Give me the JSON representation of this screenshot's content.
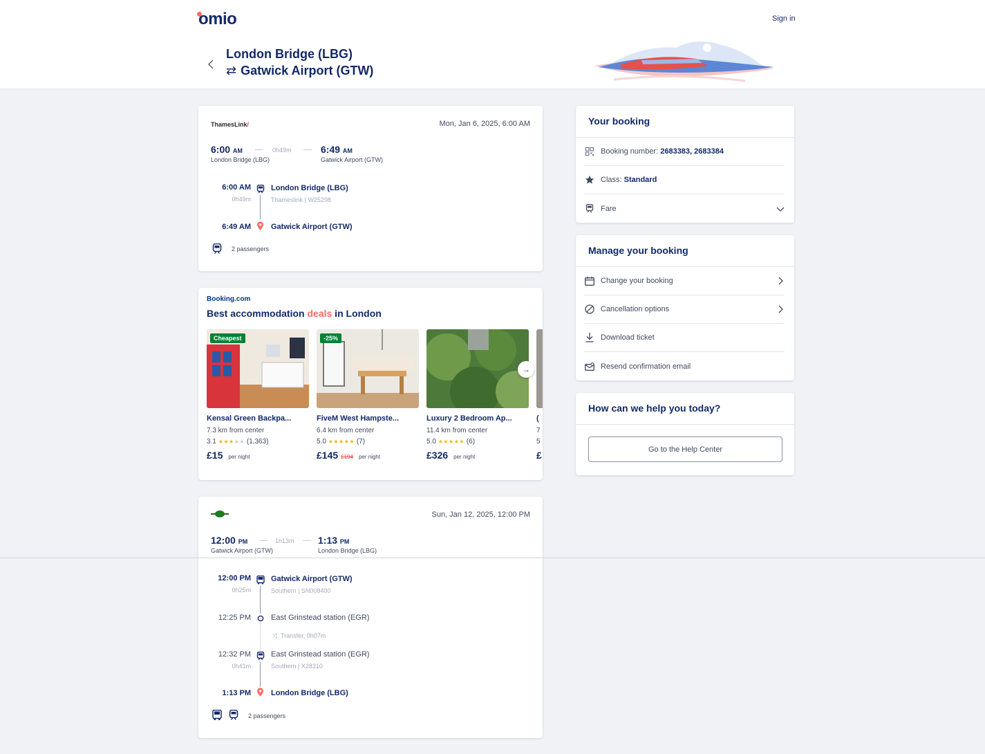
{
  "header": {
    "logo": "omio",
    "signin": "Sign in",
    "from": "London Bridge (LBG)",
    "to": "Gatwick Airport (GTW)"
  },
  "outbound": {
    "operator": "ThamesLink",
    "date": "Mon, Jan 6, 2025, 6:00 AM",
    "dep_time": "6:00",
    "dep_ampm": "AM",
    "dep_station": "London Bridge (LBG)",
    "duration": "0h49m",
    "arr_time": "6:49",
    "arr_ampm": "AM",
    "arr_station": "Gatwick Airport (GTW)",
    "legs": [
      {
        "time": "6:00 AM",
        "dur": "0h49m",
        "station": "London Bridge (LBG)",
        "sub": "Thameslink | W25298"
      },
      {
        "time": "6:49 AM",
        "station": "Gatwick Airport (GTW)"
      }
    ],
    "passengers": "2 passengers"
  },
  "accommodation": {
    "provider": "Booking.com",
    "title_start": "Best accommodation ",
    "title_deal": "deals",
    "title_end": " in London",
    "hotels": [
      {
        "badge": "Cheapest",
        "name": "Kensal Green Backpa...",
        "dist": "7.3 km from center",
        "score": "3.1",
        "stars": 3,
        "reviews": "(1,363)",
        "price": "£15",
        "old_price": "",
        "per": "per night"
      },
      {
        "badge": "-25%",
        "name": "FiveM West Hampste...",
        "dist": "6.4 km from center",
        "score": "5.0",
        "stars": 5,
        "reviews": "(7)",
        "price": "£145",
        "old_price": "£194",
        "per": "per night"
      },
      {
        "badge": "",
        "name": "Luxury 2 Bedroom Ap...",
        "dist": "11.4 km from center",
        "score": "5.0",
        "stars": 5,
        "reviews": "(6)",
        "price": "£326",
        "old_price": "",
        "per": "per night"
      }
    ],
    "overflow_letters": [
      "(",
      "7",
      "5",
      "£"
    ]
  },
  "return": {
    "date": "Sun, Jan 12, 2025, 12:00 PM",
    "dep_time": "12:00",
    "dep_ampm": "PM",
    "dep_station": "Gatwick Airport (GTW)",
    "duration": "1h13m",
    "arr_time": "1:13",
    "arr_ampm": "PM",
    "arr_station": "London Bridge (LBG)",
    "legs": [
      {
        "time": "12:00 PM",
        "dur": "0h25m",
        "station": "Gatwick Airport (GTW)",
        "sub": "Southern | SN008400"
      },
      {
        "time": "12:25 PM",
        "station": "East Grinstead station (EGR)"
      },
      {
        "transfer": "Transfer, 0h07m"
      },
      {
        "time": "12:32 PM",
        "dur": "0h41m",
        "station": "East Grinstead station (EGR)",
        "sub": "Southern | X28310"
      },
      {
        "time": "1:13 PM",
        "station": "London Bridge (LBG)"
      }
    ],
    "passengers": "2 passengers"
  },
  "your_booking": {
    "title": "Your booking",
    "booking_label": "Booking number: ",
    "booking_value": "2683383, 2683384",
    "class_label": "Class: ",
    "class_value": "Standard",
    "fare": "Fare"
  },
  "manage": {
    "title": "Manage your booking",
    "change": "Change your booking",
    "cancel": "Cancellation options",
    "download": "Download ticket",
    "resend": "Resend confirmation email"
  },
  "help": {
    "title": "How can we help you today?",
    "button": "Go to the Help Center"
  },
  "colors": {
    "brand_navy": "#132968",
    "brand_coral": "#fc6c65",
    "booking_green": "#008234"
  }
}
